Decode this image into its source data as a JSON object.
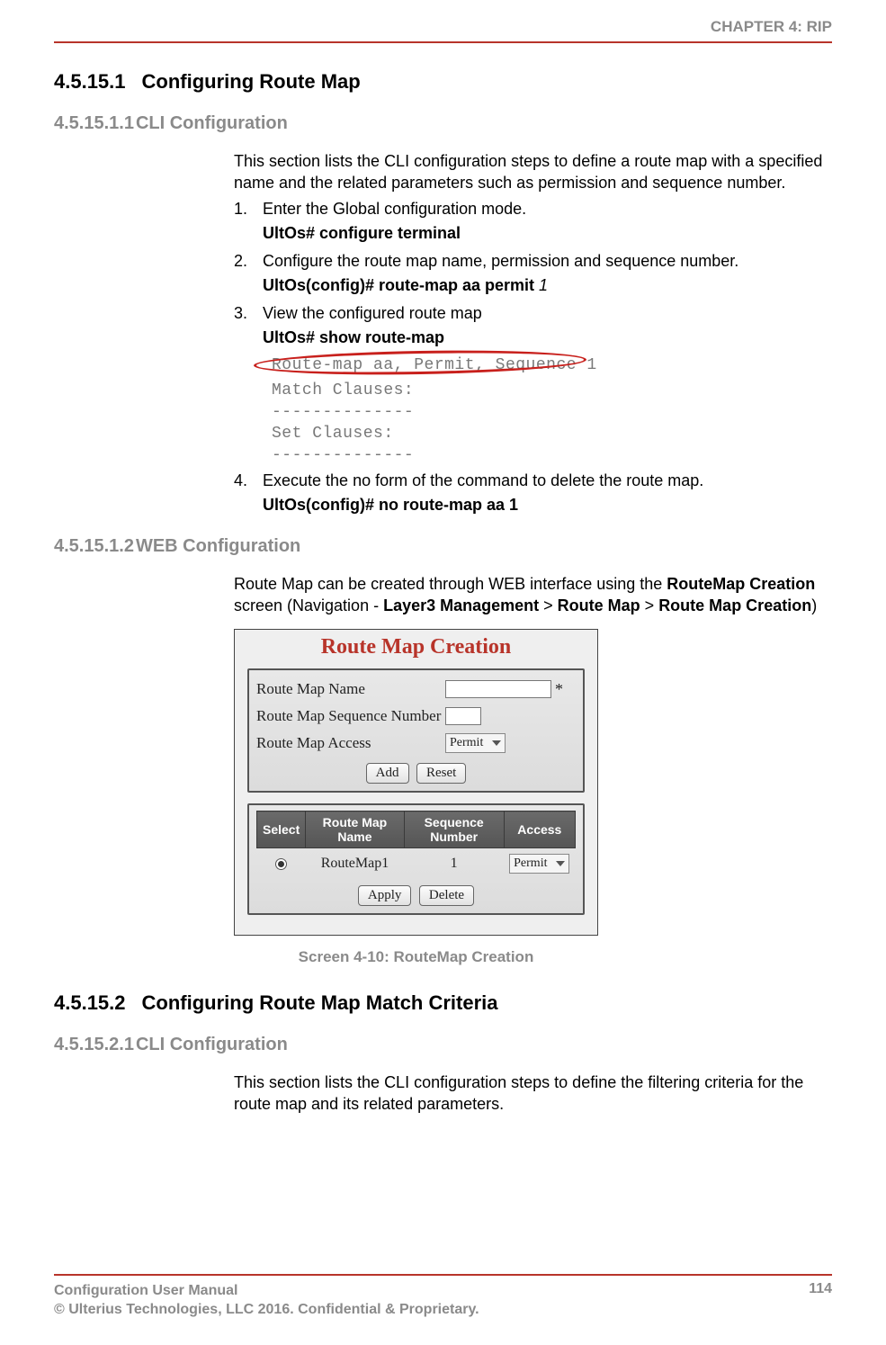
{
  "header": "CHAPTER 4: RIP",
  "s1": {
    "num": "4.5.15.1",
    "title": "Configuring Route Map"
  },
  "s1_1": {
    "num": "4.5.15.1.1",
    "title": "CLI Configuration",
    "intro": "This section lists the CLI configuration steps to define a route map with a specified name and the related parameters such as permission and sequence number.",
    "step1_num": "1.",
    "step1_text": "Enter the Global configuration mode.",
    "step1_cmd": "UltOs# configure terminal",
    "step2_num": "2.",
    "step2_text": "Configure the route map name, permission and sequence number.",
    "step2_cmd": "UltOs(config)# route-map aa permit ",
    "step2_arg": "1",
    "step3_num": "3.",
    "step3_text": "View the configured route map",
    "step3_cmd": "UltOs# show route-map",
    "out1": "Route-map aa, Permit, Sequence 1",
    "out2": "Match Clauses:",
    "out3": "--------------",
    "out4": "Set Clauses:",
    "out5": "--------------",
    "step4_num": "4.",
    "step4_text": "Execute the no form of the command to delete the route map.",
    "step4_cmd": "UltOs(config)# no route-map aa 1"
  },
  "s1_2": {
    "num": "4.5.15.1.2",
    "title": "WEB Configuration",
    "p1": "Route Map can be created through WEB interface using the ",
    "b1": "RouteMap Creation",
    "p2": " screen (Navigation - ",
    "b2": "Layer3 Management",
    "p3": " > ",
    "b3": "Route Map",
    "p4": " > ",
    "b4": "Route Map Creation",
    "p5": ")"
  },
  "ui": {
    "title": "Route Map Creation",
    "label_name": "Route Map Name",
    "label_seq": "Route Map Sequence Number",
    "label_access": "Route Map Access",
    "sel_permit": "Permit",
    "btn_add": "Add",
    "btn_reset": "Reset",
    "th_select": "Select",
    "th_name": "Route Map Name",
    "th_seq": "Sequence Number",
    "th_access": "Access",
    "row_name": "RouteMap1",
    "row_seq": "1",
    "row_access": "Permit",
    "btn_apply": "Apply",
    "btn_delete": "Delete"
  },
  "caption": "Screen 4-10: RouteMap Creation",
  "s2": {
    "num": "4.5.15.2",
    "title": "Configuring Route Map Match Criteria"
  },
  "s2_1": {
    "num": "4.5.15.2.1",
    "title": "CLI Configuration",
    "intro": "This section lists the CLI configuration steps to define the filtering criteria for the route map and its related parameters."
  },
  "footer": {
    "line1": "Configuration User Manual",
    "line2": "© Ulterius Technologies, LLC 2016. Confidential & Proprietary.",
    "page": "114"
  }
}
